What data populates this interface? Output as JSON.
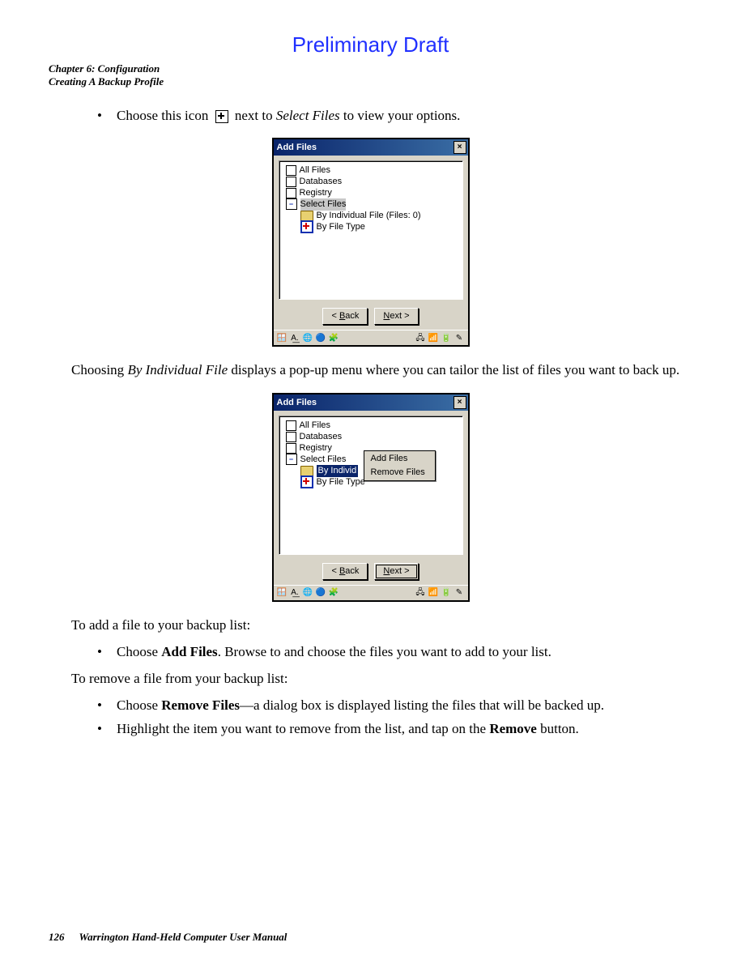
{
  "header": {
    "draft": "Preliminary Draft",
    "chapter": "Chapter 6: Configuration",
    "section": "Creating A Backup Profile"
  },
  "body": {
    "bullet1_prefix": "Choose this icon",
    "bullet1_mid": "next to ",
    "bullet1_italic": "Select Files",
    "bullet1_suffix": " to view your options.",
    "para1_a": "Choosing ",
    "para1_italic": "By Individual File",
    "para1_b": " displays a pop-up menu where you can tailor the list of files you want to back up.",
    "para2": "To add a file to your backup list:",
    "bullet2_a": "Choose ",
    "bullet2_bold": "Add Files",
    "bullet2_b": ". Browse to and choose the files you want to add to your list.",
    "para3": "To remove a file from your backup list:",
    "bullet3_a": "Choose ",
    "bullet3_bold": "Remove Files",
    "bullet3_b": "—a dialog box is displayed listing the files that will be backed up.",
    "bullet4_a": "Highlight the item you want to remove from the list, and tap on the ",
    "bullet4_bold": "Remove",
    "bullet4_b": " button."
  },
  "dialog": {
    "title": "Add Files",
    "close": "×",
    "items": {
      "all_files": "All Files",
      "databases": "Databases",
      "registry": "Registry",
      "select_files": "Select Files",
      "by_individual_full": "By Individual File (Files:  0)",
      "by_individual_short": "By Individ",
      "by_file_type": "By File Type"
    },
    "buttons": {
      "back": "< Back",
      "next": "Next >",
      "back_u": "B",
      "next_u": "N"
    },
    "menu": {
      "add": "Add Files",
      "remove": "Remove Files"
    }
  },
  "taskbar": {
    "left": [
      "🪟",
      "A͟.",
      "🌐",
      "🔵",
      "🧩"
    ],
    "right": [
      "🖧",
      "📶",
      "🔋",
      "✎"
    ]
  },
  "footer": {
    "page": "126",
    "title": "Warrington Hand-Held Computer User Manual"
  }
}
